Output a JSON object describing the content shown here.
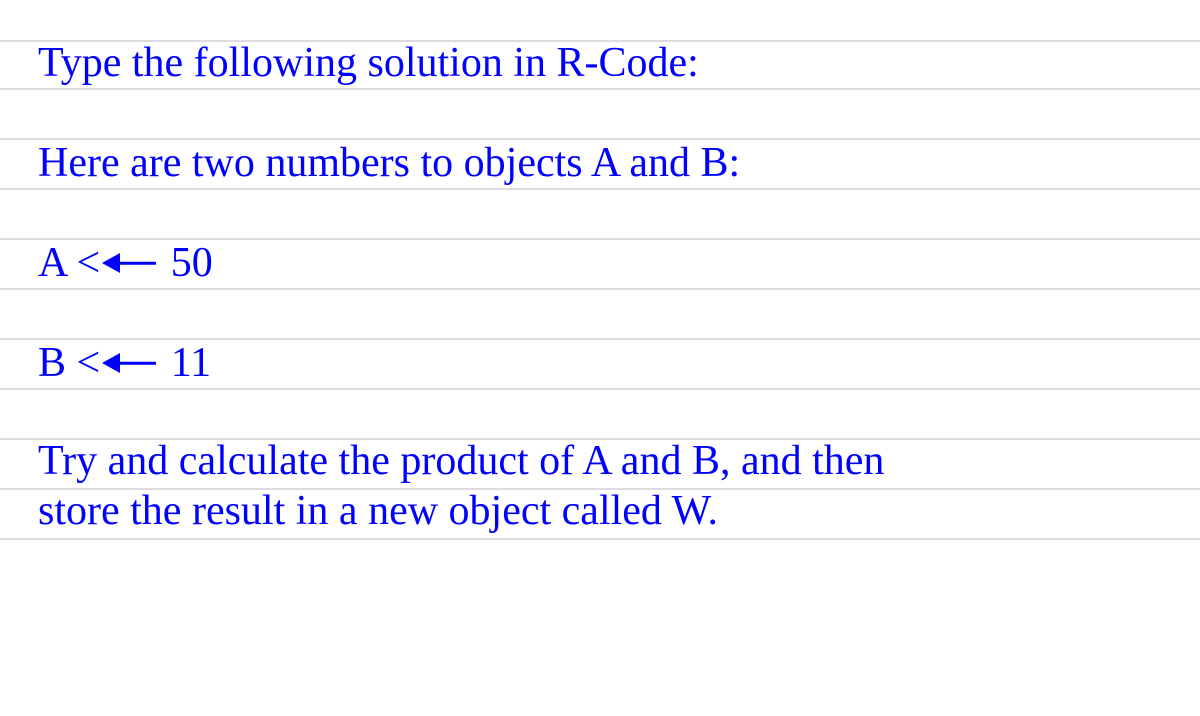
{
  "lines": {
    "l1": "Type the following solution in R-Code:",
    "l2": "Here are two numbers to objects A and B:",
    "l3_pre": "A <",
    "l3_post": " 50",
    "l4_pre": "B <",
    "l4_post": " 11",
    "l5a": "Try and calculate the product of A and B, and then",
    "l5b": "store the result in a new object called W."
  }
}
